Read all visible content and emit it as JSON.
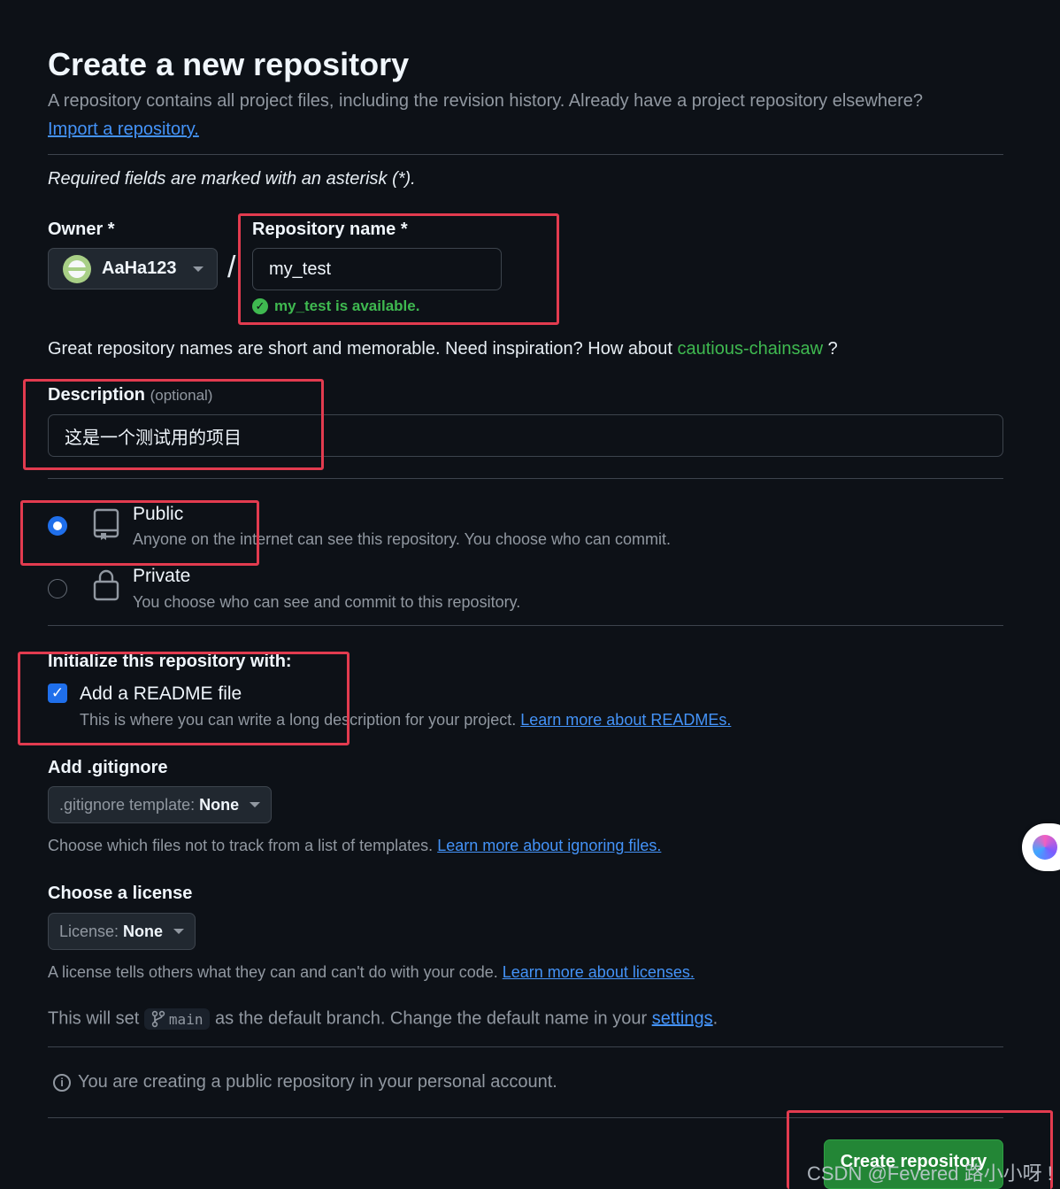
{
  "page": {
    "title": "Create a new repository",
    "subtitle": "A repository contains all project files, including the revision history. Already have a project repository elsewhere?",
    "import_link": "Import a repository.",
    "required_note": "Required fields are marked with an asterisk (*)."
  },
  "owner": {
    "label": "Owner *",
    "value": "AaHa123",
    "separator": "/"
  },
  "repo_name": {
    "label": "Repository name *",
    "value": "my_test",
    "availability": "my_test is available."
  },
  "suggestion": {
    "text_before": "Great repository names are short and memorable. Need inspiration? How about",
    "name": "cautious-chainsaw",
    "text_after": "?"
  },
  "description": {
    "label": "Description",
    "optional": "(optional)",
    "value": "这是一个测试用的项目"
  },
  "visibility": {
    "public": {
      "title": "Public",
      "desc": "Anyone on the internet can see this repository. You choose who can commit.",
      "selected": true,
      "icon": "repo-icon"
    },
    "private": {
      "title": "Private",
      "desc": "You choose who can see and commit to this repository.",
      "selected": false,
      "icon": "lock-icon"
    }
  },
  "init": {
    "label": "Initialize this repository with:",
    "readme_label": "Add a README file",
    "readme_checked": true,
    "readme_desc": "This is where you can write a long description for your project.",
    "readme_link": "Learn more about READMEs."
  },
  "gitignore": {
    "label": "Add .gitignore",
    "select_key": ".gitignore template:",
    "select_value": "None",
    "help": "Choose which files not to track from a list of templates.",
    "help_link": "Learn more about ignoring files."
  },
  "license": {
    "label": "Choose a license",
    "select_key": "License:",
    "select_value": "None",
    "help": "A license tells others what they can and can't do with your code.",
    "help_link": "Learn more about licenses."
  },
  "branch": {
    "text_before": "This will set",
    "name": "main",
    "text_after": "as the default branch. Change the default name in your",
    "settings_link": "settings",
    "period": "."
  },
  "notice": {
    "text": "You are creating a public repository in your personal account."
  },
  "submit": {
    "label": "Create repository"
  },
  "watermark": "CSDN @Fevered 路小小呀 !",
  "colors": {
    "background": "#0d1117",
    "accent_green": "#3fb950",
    "link_blue": "#4493f8",
    "primary_button": "#238636",
    "annotation_red": "#e23b4f"
  }
}
